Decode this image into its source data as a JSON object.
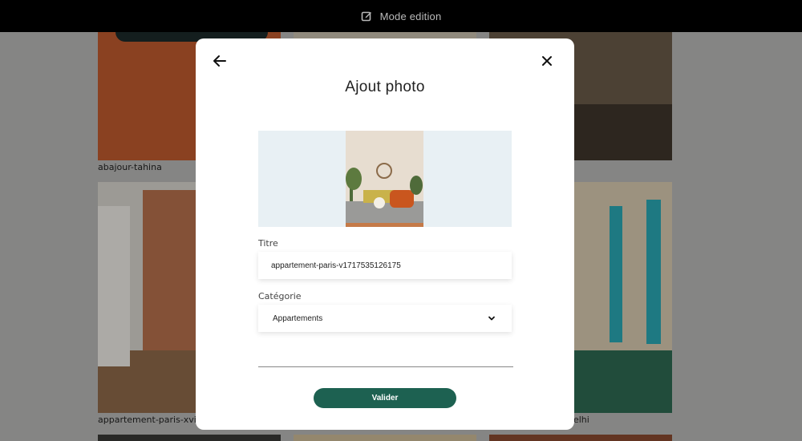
{
  "topbar": {
    "icon": "edit-icon",
    "label": "Mode edition"
  },
  "gallery": {
    "captions": [
      "abajour-tahina",
      "appartement-paris-xviii",
      "-delhi"
    ]
  },
  "modal": {
    "title": "Ajout photo",
    "back_icon": "arrow-left-icon",
    "close_icon": "close-icon",
    "form": {
      "title_label": "Titre",
      "title_value": "appartement-paris-v1717535126175",
      "category_label": "Catégorie",
      "category_value": "Appartements",
      "submit_label": "Valider"
    }
  },
  "colors": {
    "accent": "#1d6151",
    "preview_bg": "#e8f0f4",
    "topbar": "#000000"
  }
}
